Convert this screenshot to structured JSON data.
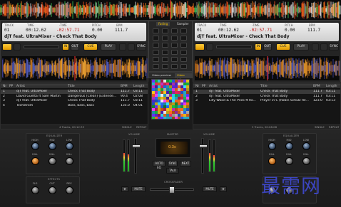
{
  "overview": {
    "desc_icon": "waveform-overview"
  },
  "deckA": {
    "labels": {
      "track": "TRACK",
      "time": "TIME",
      "remain": "-TIME",
      "pitch": "PITCH",
      "bpm": "BPM"
    },
    "track": "01",
    "time": "00:12.62",
    "remain": "-02:57.71",
    "pitch": "0.00",
    "bpm": "111.7",
    "title": "djT feat. UltraMixer - Check That Body",
    "cue": "CUE",
    "play": "PLAY",
    "in": "IN",
    "out": "OUT",
    "sync": "SYNC"
  },
  "deckB": {
    "labels": {
      "track": "TRACK",
      "time": "TIME",
      "remain": "-TIME",
      "pitch": "PITCH",
      "bpm": "BPM"
    },
    "track": "01",
    "time": "00:12.62",
    "remain": "-02:57.71",
    "pitch": "0.00",
    "bpm": "111.7",
    "title": "djT feat. UltraMixer - Check That Body",
    "cue": "CUE",
    "play": "PLAY",
    "in": "IN",
    "out": "OUT",
    "sync": "SYNC"
  },
  "center": {
    "tab_fading": "Fading",
    "tab_sampler": "Sampler",
    "video_preview": "Video preview",
    "video_info": "Video info",
    "pitch_label": "PITCH",
    "speed_label": "SPEED"
  },
  "playlistA": {
    "headers": {
      "nr": "Nr",
      "pp": "PP",
      "artist": "Artist",
      "title": "Title",
      "bpm": "BPM",
      "length": "Length"
    },
    "rows": [
      {
        "nr": "1",
        "artist": "djT feat. UltraMixer",
        "title": "Check That Body",
        "bpm": "111.7",
        "length": "03:11"
      },
      {
        "nr": "2",
        "artist": "David Guetta ft Sam Martin",
        "title": "Dangerous (Clean) (Extende...",
        "bpm": "90.4",
        "length": "02:08"
      },
      {
        "nr": "3",
        "artist": "djT feat. UltraMixer",
        "title": "Check That Body",
        "bpm": "111.7",
        "length": "03:11"
      },
      {
        "nr": "4",
        "artist": "Techstrom",
        "title": "Bass, bass, bass",
        "bpm": "135.0",
        "length": "04:01"
      }
    ],
    "footer": "4 Tracks, 00:12:33",
    "single": "SINGLE",
    "repeat": "REPEAT"
  },
  "playlistB": {
    "headers": {
      "nr": "Nr",
      "pp": "PP",
      "artist": "Artist",
      "title": "Title",
      "bpm": "BPM",
      "length": "Length"
    },
    "rows": [
      {
        "nr": "1",
        "artist": "djT feat. UltraMixer",
        "title": "Check That Body",
        "bpm": "111.7",
        "length": "03:11"
      },
      {
        "nr": "2",
        "artist": "djT feat. UltraMixer",
        "title": "Check That Body",
        "bpm": "111.7",
        "length": "03:11"
      },
      {
        "nr": "3",
        "artist": "Lilly Wood & The Prick ft Ro...",
        "title": "Prayer in C (Robin Schulz Re...",
        "bpm": "123.0",
        "length": "03:13"
      }
    ],
    "footer": "3 Tracks, 00:08:08",
    "single": "SINGLE",
    "repeat": "REPEAT"
  },
  "mixer": {
    "equalizer": "EQUALIZER",
    "effects": "EFFECTS",
    "volume": "VOLUME",
    "master": "MASTER",
    "crossfader": "CROSSFADER",
    "high": "HIGH",
    "mid": "MID",
    "low": "LOW",
    "kill": "KILL",
    "fx1": "FLG",
    "fx2": "CUT",
    "fx3": "REV",
    "auto_eq": "AUTO EQ",
    "sync": "SYNC",
    "next": "NEXT",
    "talk": "TALK",
    "mute": "MUTE",
    "bpm_display": "0.3s"
  },
  "watermark": "最需网"
}
